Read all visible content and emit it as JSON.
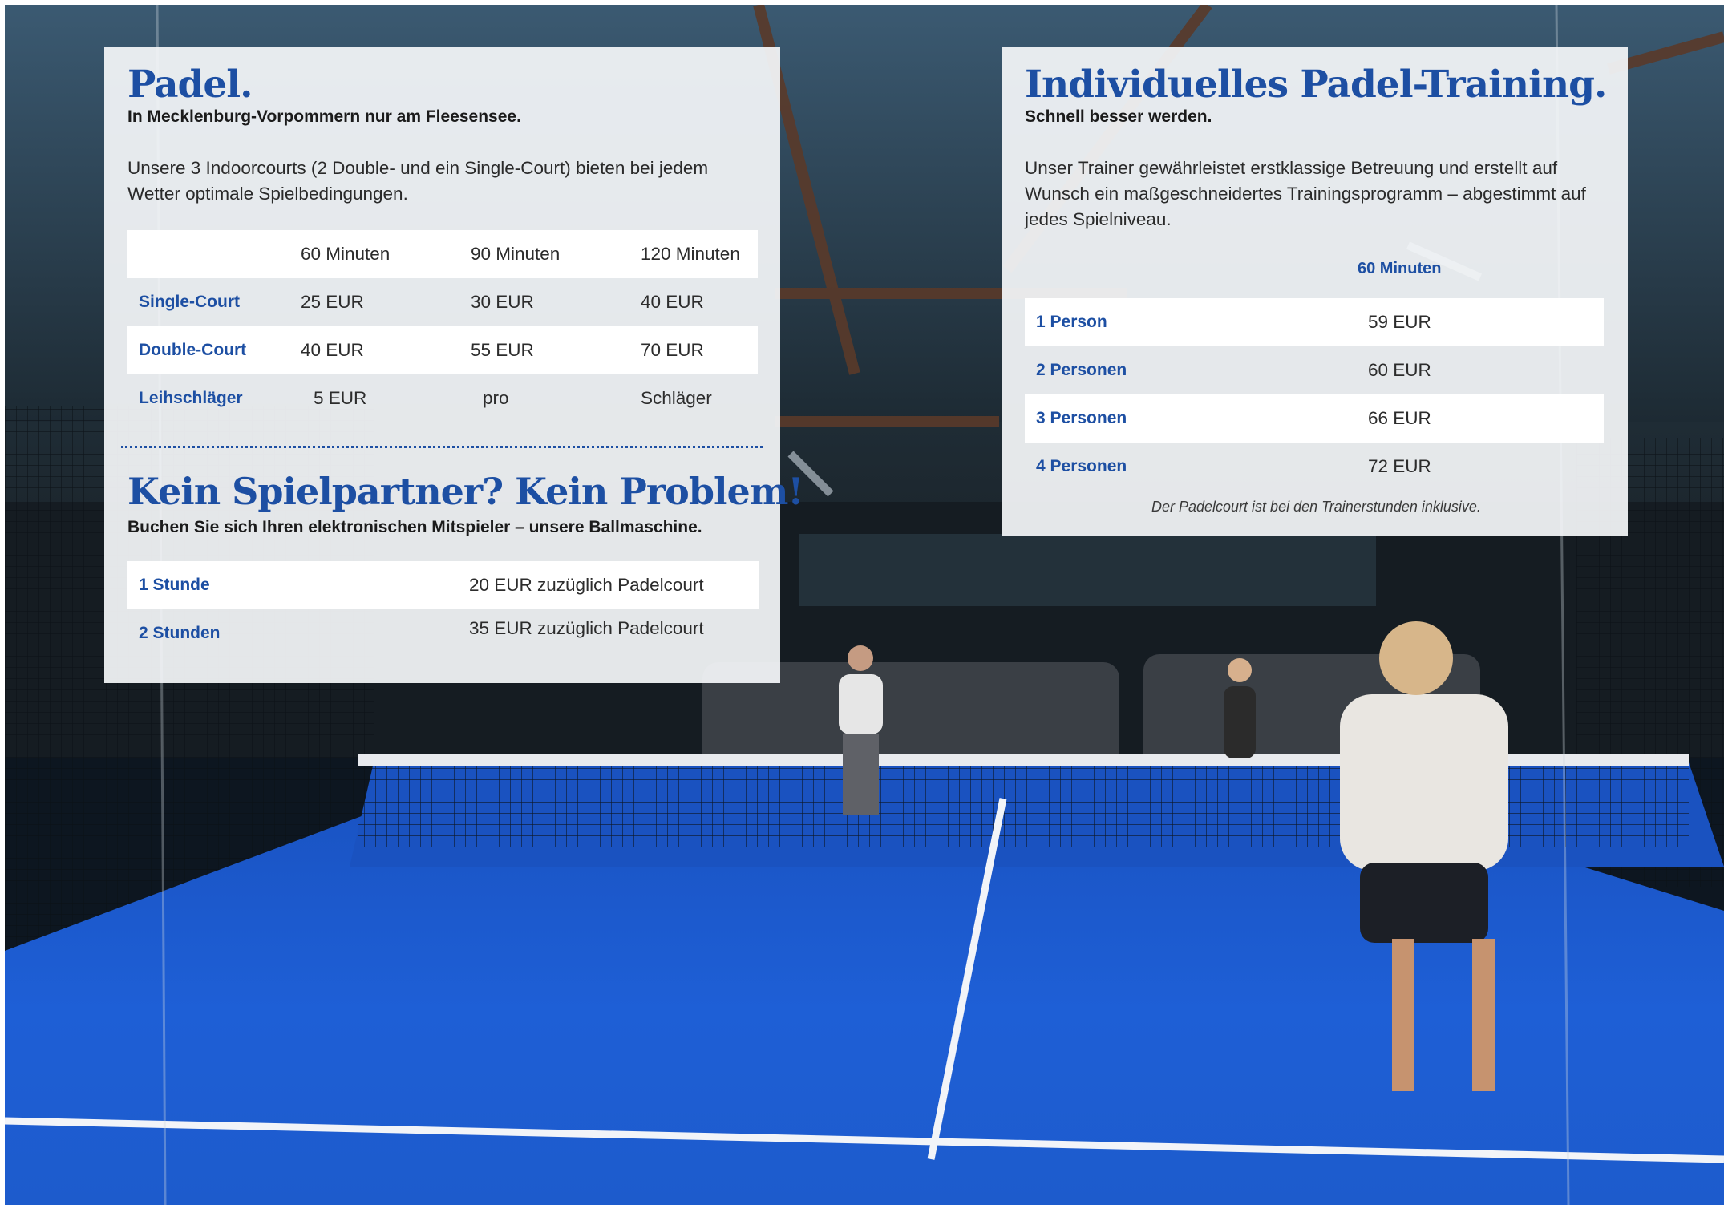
{
  "padel": {
    "title": "Padel.",
    "subtitle": "In Mecklenburg-Vorpommern nur am Fleesensee.",
    "description": "Unsere 3 Indoorcourts (2 Double- und ein Single-Court) bieten bei jedem Wetter optimale Spielbedingungen.",
    "table": {
      "headers": [
        "60 Minuten",
        "90 Minuten",
        "120 Minuten"
      ],
      "rows": [
        {
          "label": "Single-Court",
          "values": [
            "25 EUR",
            "30 EUR",
            "40 EUR"
          ]
        },
        {
          "label": "Double-Court",
          "values": [
            "40 EUR",
            "55 EUR",
            "70 EUR"
          ]
        },
        {
          "label": "Leihschläger",
          "values": [
            "5 EUR",
            "pro",
            "Schläger"
          ]
        }
      ]
    }
  },
  "ballmachine": {
    "title": "Kein Spielpartner? Kein Problem!",
    "subtitle": "Buchen Sie sich Ihren elektronischen Mitspieler – unsere Ballmaschine.",
    "rows": [
      {
        "label": "1 Stunde",
        "value": "20 EUR zuzüglich Padelcourt"
      },
      {
        "label": "2 Stunden",
        "value": "35 EUR zuzüglich Padelcourt"
      }
    ]
  },
  "training": {
    "title": "Individuelles Padel-Training.",
    "subtitle": "Schnell besser werden.",
    "description": "Unser Trainer gewährleistet erstklassige Betreuung und erstellt auf Wunsch ein maßgeschneidertes Trainingsprogramm – abgestimmt auf jedes Spielniveau.",
    "column_header": "60 Minuten",
    "rows": [
      {
        "label": "1 Person",
        "value": "59 EUR"
      },
      {
        "label": "2 Personen",
        "value": "60 EUR"
      },
      {
        "label": "3 Personen",
        "value": "66 EUR"
      },
      {
        "label": "4 Personen",
        "value": "72 EUR"
      }
    ],
    "note": "Der Padelcourt ist bei den Trainerstunden inklusive."
  },
  "colors": {
    "accent": "#1d4fa3",
    "court": "#1f5fd0",
    "card": "#f4f6f9"
  }
}
